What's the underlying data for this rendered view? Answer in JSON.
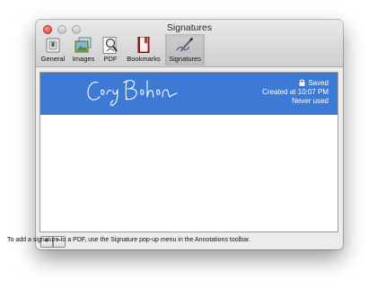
{
  "window": {
    "title": "Signatures",
    "controls": [
      "close-button",
      "minimize-button",
      "zoom-button"
    ]
  },
  "toolbar": {
    "items": [
      {
        "label": "General",
        "icon": "general-switch-icon",
        "selected": false
      },
      {
        "label": "Images",
        "icon": "images-icon",
        "selected": false
      },
      {
        "label": "PDF",
        "icon": "pdf-magnifier-icon",
        "selected": false
      },
      {
        "label": "Bookmarks",
        "icon": "bookmarks-book-icon",
        "selected": false
      },
      {
        "label": "Signatures",
        "icon": "signature-pen-icon",
        "selected": true
      }
    ]
  },
  "signatures": {
    "rows": [
      {
        "signature_image": "Cory Bohon",
        "status": "Saved",
        "created": "Created at 10:07 PM",
        "usage": "Never used",
        "selected": true
      }
    ]
  },
  "buttons": {
    "add_label": "+",
    "remove_label": "−"
  },
  "hint": "To add a signature to a PDF, use the Signature pop-up menu in the Annotations toolbar.",
  "colors": {
    "selection": "#3d7ad6",
    "window_background": "#ececec",
    "close_button": "#e0463f"
  }
}
